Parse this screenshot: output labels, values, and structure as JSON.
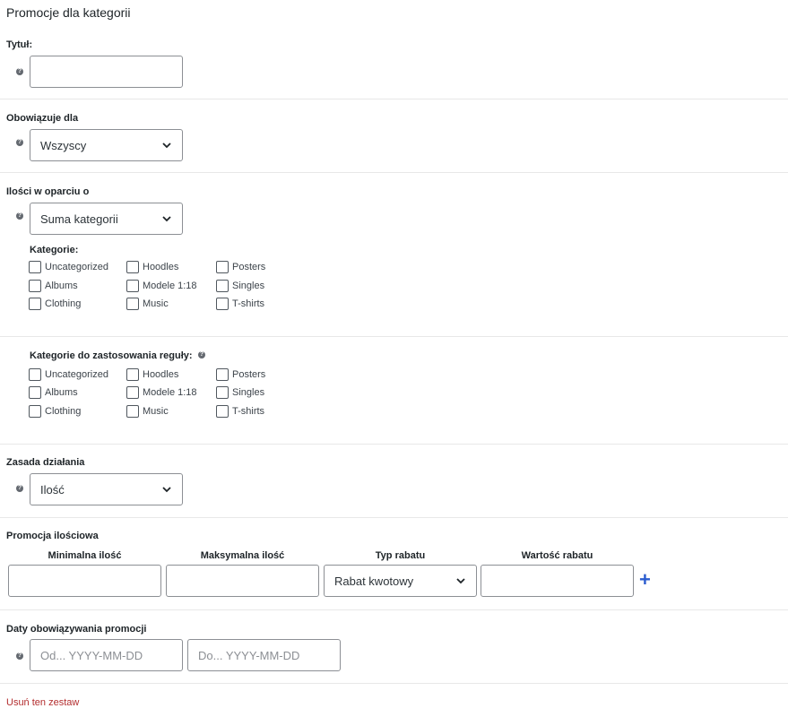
{
  "page_title": "Promocje dla kategorii",
  "help_glyph": "?",
  "title_section": {
    "label": "Tytuł:",
    "value": ""
  },
  "applies_to": {
    "label": "Obowiązuje dla",
    "selected": "Wszyscy"
  },
  "quantity_basis": {
    "label": "Ilości w oparciu o",
    "selected": "Suma kategorii",
    "categories_label": "Kategorie:",
    "categories": [
      [
        "Uncategorized",
        "Hoodles",
        "Posters"
      ],
      [
        "Albums",
        "Modele 1:18",
        "Singles"
      ],
      [
        "Clothing",
        "Music",
        "T-shirts"
      ]
    ]
  },
  "rule_categories": {
    "label": "Kategorie do zastosowania reguły:",
    "categories": [
      [
        "Uncategorized",
        "Hoodles",
        "Posters"
      ],
      [
        "Albums",
        "Modele 1:18",
        "Singles"
      ],
      [
        "Clothing",
        "Music",
        "T-shirts"
      ]
    ]
  },
  "rule": {
    "label": "Zasada działania",
    "selected": "Ilość"
  },
  "quantity_promo": {
    "label": "Promocja ilościowa",
    "headers": [
      "Minimalna ilość",
      "Maksymalna ilość",
      "Typ rabatu",
      "Wartość rabatu"
    ],
    "discount_type": "Rabat kwotowy",
    "add_glyph": "+"
  },
  "dates": {
    "label": "Daty obowiązywania promocji",
    "from_placeholder": "Od... YYYY-MM-DD",
    "to_placeholder": "Do... YYYY-MM-DD"
  },
  "remove_label": "Usuń ten zestaw",
  "colors": {
    "accent": "#2b5ccf",
    "danger": "#b32d2e",
    "border": "#8c8f94"
  }
}
